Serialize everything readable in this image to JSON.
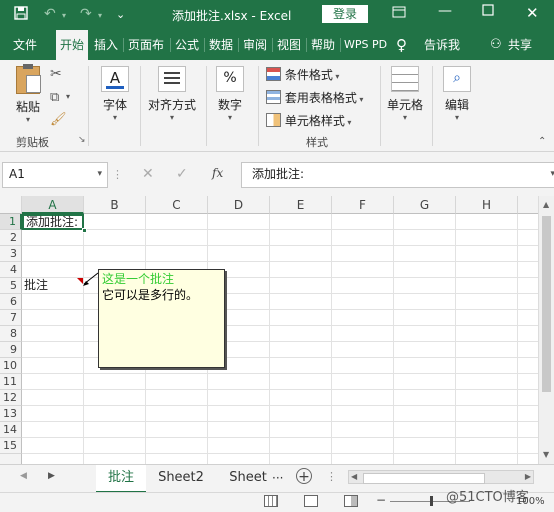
{
  "titlebar": {
    "title": "添加批注.xlsx  -  Excel",
    "login": "登录",
    "save_icon": "save-icon",
    "undo_icon": "undo-icon",
    "redo_icon": "redo-icon"
  },
  "tabs": [
    "文件",
    "开始",
    "插入",
    "页面布",
    "公式",
    "数据",
    "审阅",
    "视图",
    "帮助",
    "WPS PD"
  ],
  "tell_me": "告诉我",
  "share": "共享",
  "ribbon": {
    "paste": "粘贴",
    "clipboard": "剪贴板",
    "font": "字体",
    "align": "对齐方式",
    "number": "数字",
    "cond_format": "条件格式",
    "table_format": "套用表格格式",
    "cell_style": "单元格样式",
    "styles": "样式",
    "cells": "单元格",
    "editing": "编辑"
  },
  "formula_bar": {
    "name_box": "A1",
    "fx": "fx",
    "content": "添加批注:"
  },
  "columns": [
    "A",
    "B",
    "C",
    "D",
    "E",
    "F",
    "G",
    "H"
  ],
  "rows": [
    "1",
    "2",
    "3",
    "4",
    "5",
    "6",
    "7",
    "8",
    "9",
    "10",
    "11",
    "12",
    "13",
    "14",
    "15"
  ],
  "cells": {
    "a1": "添加批注:",
    "a5": "批注"
  },
  "comment": {
    "line1": "这是一个批注",
    "line2": "它可以是多行的。"
  },
  "sheets": [
    "批注",
    "Sheet2",
    "Sheet"
  ],
  "sheet_more": "···",
  "zoom": "100%",
  "watermark": "@51CTO博客",
  "colors": {
    "brand": "#217346",
    "comment_bg": "#ffffe1",
    "comment_text_green": "#33cc33"
  }
}
